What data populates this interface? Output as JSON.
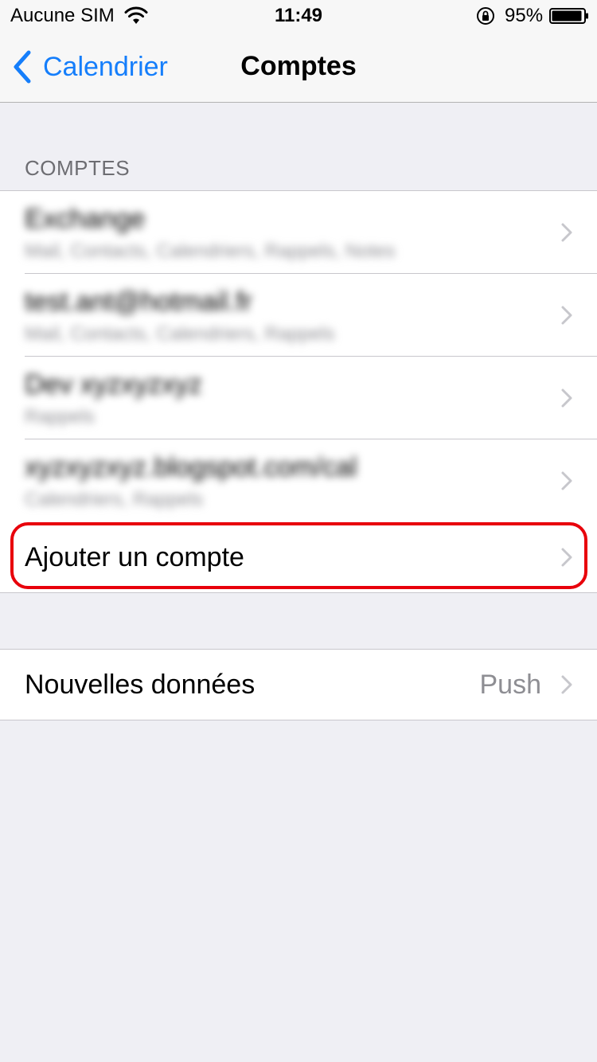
{
  "status_bar": {
    "carrier": "Aucune SIM",
    "time": "11:49",
    "battery_percent": "95%",
    "battery_level": 0.95,
    "icons": [
      "wifi-icon",
      "orientation-lock-icon",
      "battery-icon"
    ]
  },
  "nav": {
    "back_label": "Calendrier",
    "title": "Comptes",
    "accent_color": "#157efb"
  },
  "accounts_section": {
    "header": "COMPTES",
    "accounts": [
      {
        "name": "Exchange",
        "services": "Mail, Contacts, Calendriers, Rappels, Notes"
      },
      {
        "name": "test.ant@hotmail.fr",
        "services": "Mail, Contacts, Calendriers, Rappels"
      },
      {
        "name": "Dev xyzxyzxyz",
        "services": "Rappels"
      },
      {
        "name": "xyzxyzxyz.blogspot.com/cal",
        "services": "Calendriers, Rappels"
      }
    ],
    "add_account_label": "Ajouter un compte",
    "highlight_color": "#e8000b"
  },
  "fetch_section": {
    "label": "Nouvelles données",
    "value": "Push"
  }
}
